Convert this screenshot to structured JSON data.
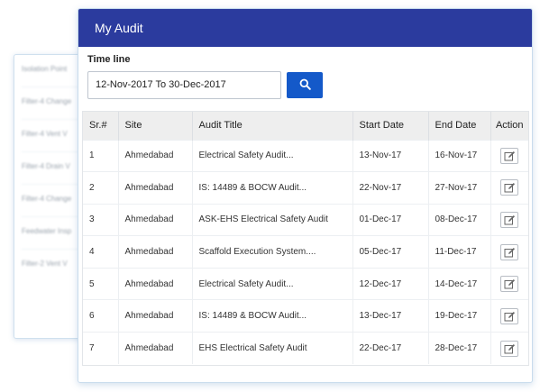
{
  "background_panel": {
    "items": [
      "Isolation Point",
      "Filter-4 Change",
      "Filter-4 Vent V",
      "Filter-4 Drain V",
      "Filter-4 Change",
      "Feedwater Insp",
      "Filter-2 Vent V"
    ]
  },
  "header": {
    "title": "My Audit"
  },
  "timeline": {
    "label": "Time line",
    "value": "12-Nov-2017 To 30-Dec-2017"
  },
  "table": {
    "columns": [
      "Sr.#",
      "Site",
      "Audit Title",
      "Start Date",
      "End Date",
      "Action"
    ],
    "rows": [
      {
        "sr": "1",
        "site": "Ahmedabad",
        "title": "Electrical Safety Audit...",
        "start": "13-Nov-17",
        "end": "16-Nov-17"
      },
      {
        "sr": "2",
        "site": "Ahmedabad",
        "title": "IS: 14489 & BOCW Audit...",
        "start": "22-Nov-17",
        "end": "27-Nov-17"
      },
      {
        "sr": "3",
        "site": "Ahmedabad",
        "title": "ASK-EHS Electrical Safety Audit",
        "start": "01-Dec-17",
        "end": "08-Dec-17"
      },
      {
        "sr": "4",
        "site": "Ahmedabad",
        "title": "Scaffold Execution System....",
        "start": "05-Dec-17",
        "end": "11-Dec-17"
      },
      {
        "sr": "5",
        "site": "Ahmedabad",
        "title": "Electrical Safety Audit...",
        "start": "12-Dec-17",
        "end": "14-Dec-17"
      },
      {
        "sr": "6",
        "site": "Ahmedabad",
        "title": "IS: 14489 & BOCW Audit...",
        "start": "13-Dec-17",
        "end": "19-Dec-17"
      },
      {
        "sr": "7",
        "site": "Ahmedabad",
        "title": "EHS Electrical Safety Audit",
        "start": "22-Dec-17",
        "end": "28-Dec-17"
      }
    ]
  },
  "icons": {
    "search": "search-icon",
    "edit": "edit-icon"
  },
  "colors": {
    "header_bg": "#2b3b9e",
    "search_btn": "#1459c9"
  }
}
